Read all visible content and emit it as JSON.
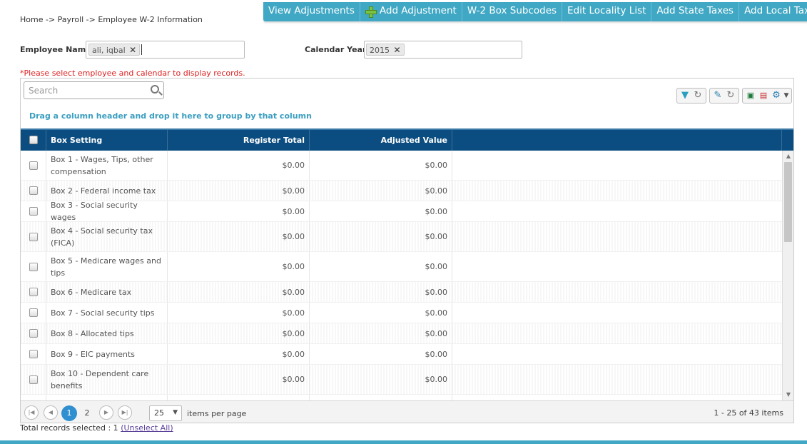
{
  "breadcrumb": "Home -> Payroll -> Employee W-2 Information",
  "topnav": [
    {
      "label": "View Adjustments"
    },
    {
      "label": "Add Adjustment",
      "icon": "plus-icon"
    },
    {
      "label": "W-2 Box Subcodes"
    },
    {
      "label": "Edit Locality List"
    },
    {
      "label": "Add State Taxes"
    },
    {
      "label": "Add Local Taxes"
    }
  ],
  "filters": {
    "employee_label": "Employee Name",
    "employee_chip": "ali, iqbal",
    "year_label": "Calendar Year",
    "year_chip": "2015",
    "remove_glyph": "✕"
  },
  "warning": "*Please select employee and calendar to display records.",
  "search": {
    "placeholder": "Search"
  },
  "group_hint": "Drag a column header and drop it here to group by that column",
  "columns": {
    "box": "Box Setting",
    "register": "Register Total",
    "adjusted": "Adjusted Value"
  },
  "rows": [
    {
      "box": "Box 1 - Wages, Tips, other compensation",
      "register": "$0.00",
      "adjusted": "$0.00"
    },
    {
      "box": "Box 2 - Federal income tax",
      "register": "$0.00",
      "adjusted": "$0.00"
    },
    {
      "box": "Box 3 - Social security wages",
      "register": "$0.00",
      "adjusted": "$0.00"
    },
    {
      "box": "Box 4 - Social security tax (FICA)",
      "register": "$0.00",
      "adjusted": "$0.00"
    },
    {
      "box": "Box 5 - Medicare wages and tips",
      "register": "$0.00",
      "adjusted": "$0.00"
    },
    {
      "box": "Box 6 - Medicare tax",
      "register": "$0.00",
      "adjusted": "$0.00"
    },
    {
      "box": "Box 7 - Social security tips",
      "register": "$0.00",
      "adjusted": "$0.00"
    },
    {
      "box": "Box 8 - Allocated tips",
      "register": "$0.00",
      "adjusted": "$0.00"
    },
    {
      "box": "Box 9 - EIC payments",
      "register": "$0.00",
      "adjusted": "$0.00"
    },
    {
      "box": "Box 10 - Dependent care benefits",
      "register": "$0.00",
      "adjusted": "$0.00"
    }
  ],
  "pager": {
    "pages": [
      "1",
      "2"
    ],
    "current": "1",
    "page_size": "25",
    "items_per_page": "items per page",
    "info": "1 - 25 of 43 items"
  },
  "footer": {
    "selected_text": "Total records selected : 1",
    "unselect_link": "(Unselect All)"
  },
  "colors": {
    "accent": "#40a8c4",
    "header": "#0b4d80",
    "warning": "#e02020"
  }
}
